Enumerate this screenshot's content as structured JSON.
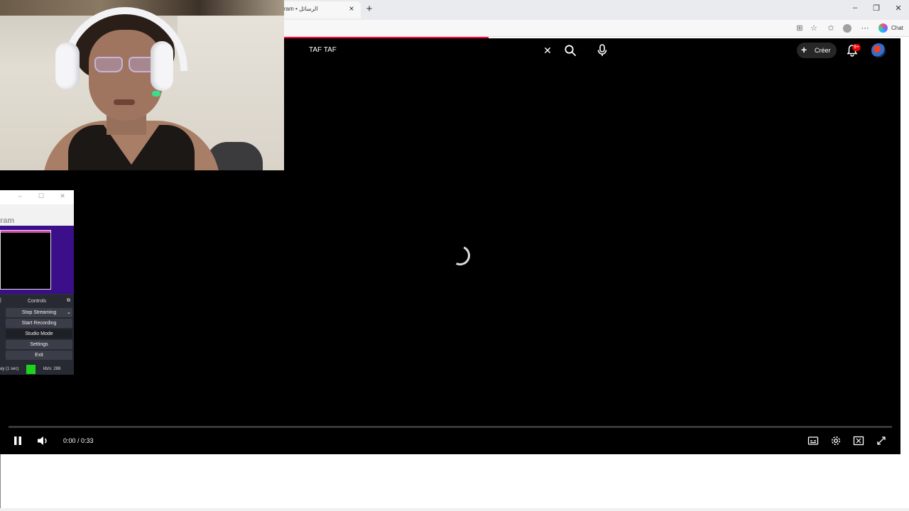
{
  "browser": {
    "tab_title": "ram • الرسائل",
    "tab_close": "×",
    "new_tab": "+",
    "window_controls": [
      "–",
      "❐",
      "✕"
    ],
    "toolbar_icons": [
      "reading-view-icon",
      "favorite-star-icon",
      "favorites-icon",
      "profile-icon",
      "more-icon"
    ],
    "chat_label": "Chat"
  },
  "youtube": {
    "search_query": "TAF TAF",
    "create_label": "Créer",
    "notification_badge": "9+",
    "accent_color": "#ff0033"
  },
  "player": {
    "current_time": "0:00",
    "duration": "0:33",
    "time_display": "0:00 / 0:33",
    "state": "loading",
    "progress": 0
  },
  "obs": {
    "program_label": "ram",
    "controls_title": "Controls",
    "buttons": {
      "stop_streaming": "Stop Streaming",
      "start_recording": "Start Recording",
      "studio_mode": "Studio Mode",
      "settings": "Settings",
      "exit": "Exit"
    },
    "status_left": "ay (1 sec)",
    "status_kbs": "kb/s: 288",
    "status_color": "#1ed31e"
  }
}
